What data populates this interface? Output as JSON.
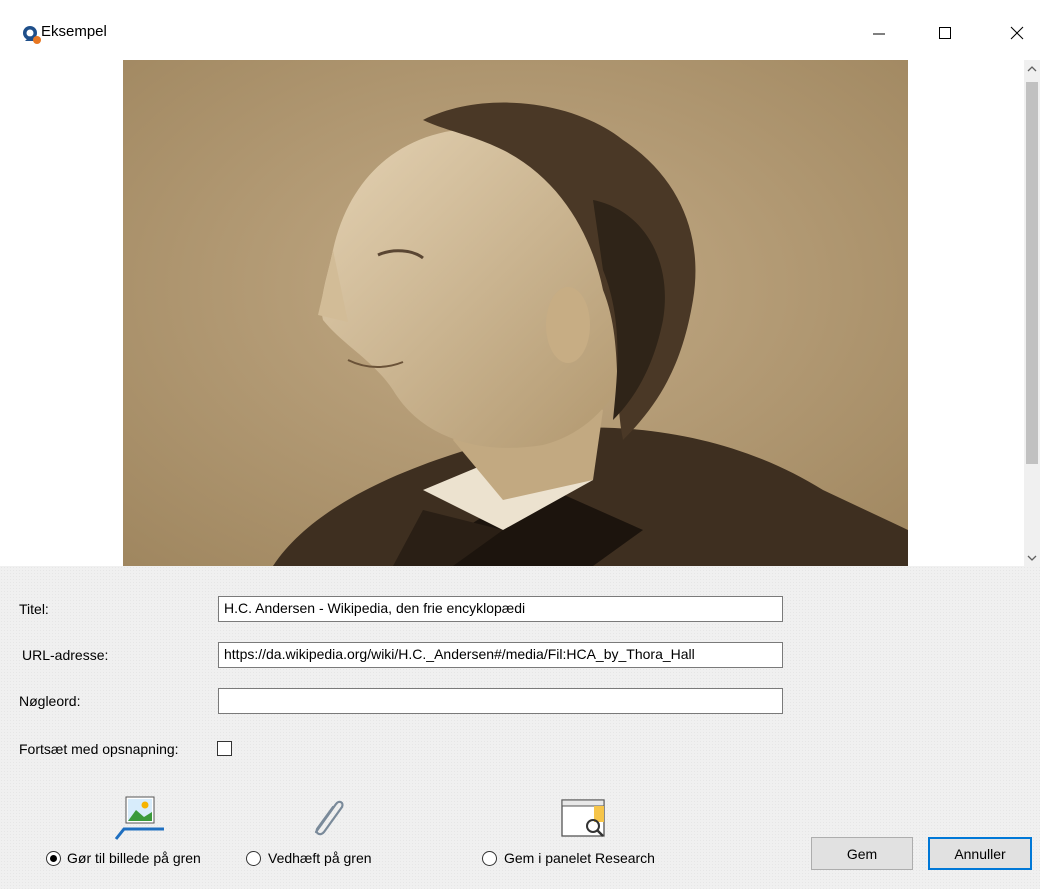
{
  "window": {
    "title": "Eksempel",
    "icons": {
      "app": "app-icon",
      "minimize": "minimize-icon",
      "maximize": "maximize-icon",
      "close": "close-icon"
    }
  },
  "preview": {
    "image": "portrait-photo",
    "scrollbar": {
      "up": "chevron-up-icon",
      "down": "chevron-down-icon"
    }
  },
  "form": {
    "title_label": "Titel:",
    "title_value": "H.C. Andersen - Wikipedia, den frie encyklopædi",
    "url_label": "URL-adresse:",
    "url_value": "https://da.wikipedia.org/wiki/H.C._Andersen#/media/Fil:HCA_by_Thora_Hall",
    "keywords_label": "Nøgleord:",
    "keywords_value": "",
    "continue_label": "Fortsæt med opsnapning:",
    "continue_checked": false
  },
  "options": {
    "selected": "image",
    "items": [
      {
        "id": "image",
        "label": "Gør til billede på gren",
        "icon": "picture-branch-icon"
      },
      {
        "id": "attach",
        "label": "Vedhæft på gren",
        "icon": "paperclip-icon"
      },
      {
        "id": "research",
        "label": "Gem i panelet Research",
        "icon": "research-panel-icon"
      }
    ]
  },
  "buttons": {
    "save": "Gem",
    "cancel": "Annuller"
  },
  "colors": {
    "accent": "#0078d7",
    "form_bg": "#f0f0f0",
    "photo_sepia": "#b9a078"
  }
}
